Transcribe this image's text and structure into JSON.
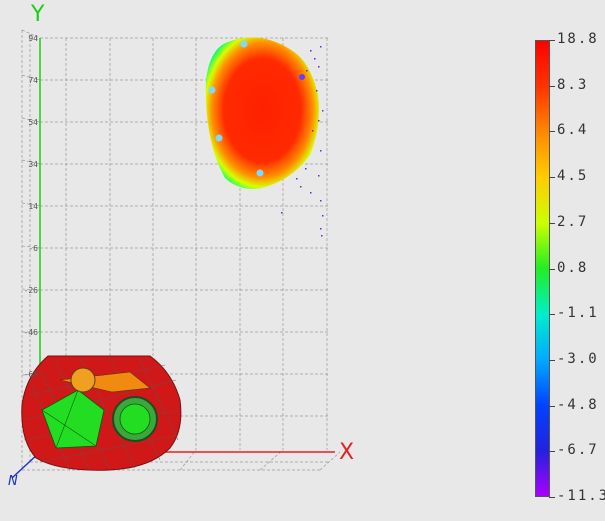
{
  "viewport": {
    "axis_labels": {
      "y": "Y",
      "x": "X",
      "z": "N"
    },
    "y_ticks": [
      "94",
      "74",
      "54",
      "34",
      "14",
      "-6",
      "-26",
      "-46",
      "-66"
    ],
    "colors": {
      "y_axis": "#18d018",
      "x_axis": "#e82020",
      "z_axis": "#2030d0",
      "grid": "#9a9a9a"
    }
  },
  "colorbar": {
    "labels": [
      "18.8",
      "8.3",
      "6.4",
      "4.5",
      "2.7",
      "0.8",
      "-1.1",
      "-3.0",
      "-4.8",
      "-6.7",
      "-11.3"
    ],
    "gradient": [
      "#ff0000",
      "#ff3300",
      "#ff8800",
      "#ffcc00",
      "#ccff00",
      "#22ee22",
      "#00eecc",
      "#00aaff",
      "#0044ff",
      "#2222dd",
      "#aa00ff"
    ]
  }
}
